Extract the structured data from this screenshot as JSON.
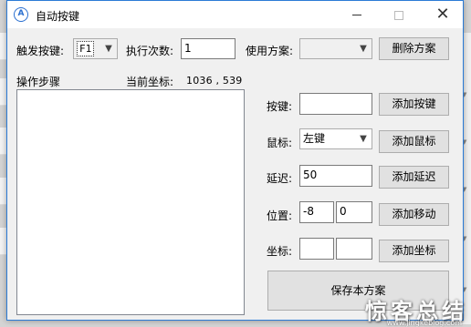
{
  "window": {
    "title": "自动按键",
    "app_icon_glyph": "A"
  },
  "toolbar": {
    "trigger_key_label": "触发按键:",
    "trigger_key_value": "F1",
    "repeat_count_label": "执行次数:",
    "repeat_count_value": "1",
    "scheme_label": "使用方案:",
    "scheme_value": "",
    "delete_scheme_button": "删除方案"
  },
  "steps": {
    "label": "操作步骤",
    "current_coord_label": "当前坐标:",
    "current_coord_value": "1036 , 539",
    "items": []
  },
  "form": {
    "key_label": "按键:",
    "key_value": "",
    "add_key_button": "添加按键",
    "mouse_label": "鼠标:",
    "mouse_value": "左键",
    "add_mouse_button": "添加鼠标",
    "delay_label": "延迟:",
    "delay_value": "50",
    "add_delay_button": "添加延迟",
    "position_label": "位置:",
    "position_x": "-8",
    "position_y": "0",
    "add_move_button": "添加移动",
    "coord_label": "坐标:",
    "coord_x": "",
    "coord_y": "",
    "add_coord_button": "添加坐标",
    "save_scheme_button": "保存本方案"
  },
  "watermark": {
    "text": "惊客总结",
    "url": "www.jingkeblog.com"
  },
  "colors": {
    "accent": "#2b7bd6",
    "window_bg": "#f0f0f0",
    "button_bg": "#e1e1e1"
  },
  "icons": {
    "dropdown": "chevron-down-icon",
    "minimize": "minimize-icon",
    "maximize": "maximize-icon",
    "close": "close-icon"
  }
}
